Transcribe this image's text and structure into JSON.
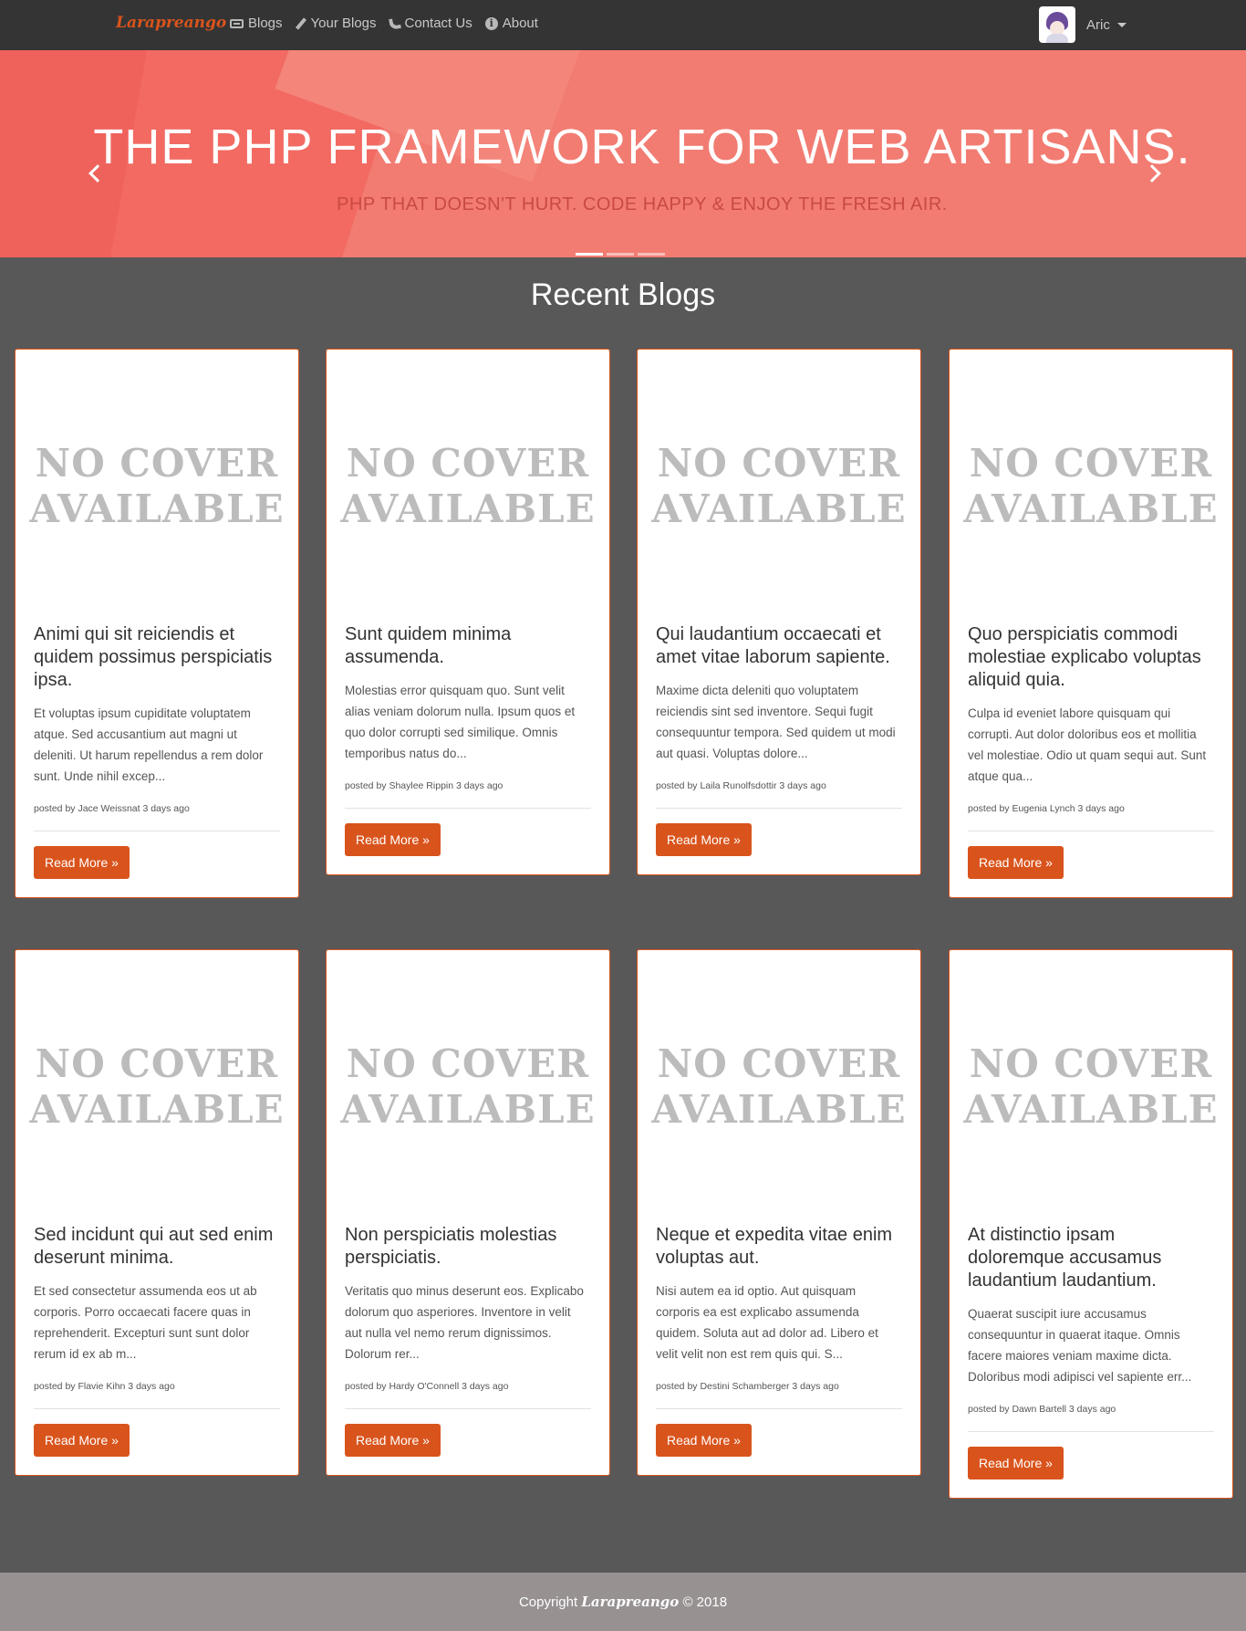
{
  "nav": {
    "brand": "Larapreango",
    "links": [
      {
        "label": "Blogs",
        "icon": "keyboard-icon"
      },
      {
        "label": "Your Blogs",
        "icon": "pencil-icon"
      },
      {
        "label": "Contact Us",
        "icon": "phone-icon"
      },
      {
        "label": "About",
        "icon": "info-icon"
      }
    ],
    "user": "Aric"
  },
  "hero": {
    "title": "THE PHP FRAMEWORK FOR WEB ARTISANS.",
    "subtitle": "PHP THAT DOESN'T HURT. CODE HAPPY & ENJOY THE FRESH AIR.",
    "slides": 3,
    "active_slide": 1
  },
  "section_title": "Recent Blogs",
  "cover_placeholder": [
    "NO COVER",
    "AVAILABLE"
  ],
  "read_more": "Read More »",
  "posts": [
    {
      "title": "Animi qui sit reiciendis et quidem possimus perspiciatis ipsa.",
      "excerpt": "Et voluptas ipsum cupiditate voluptatem atque. Sed accusantium aut magni ut deleniti. Ut harum repellendus a rem dolor sunt. Unde nihil excep...",
      "meta": "posted by Jace Weissnat 3 days ago"
    },
    {
      "title": "Sunt quidem minima assumenda.",
      "excerpt": "Molestias error quisquam quo. Sunt velit alias veniam dolorum nulla. Ipsum quos et quo dolor corrupti sed similique. Omnis temporibus natus do...",
      "meta": "posted by Shaylee Rippin 3 days ago"
    },
    {
      "title": "Qui laudantium occaecati et amet vitae laborum sapiente.",
      "excerpt": "Maxime dicta deleniti quo voluptatem reiciendis sint sed inventore. Sequi fugit consequuntur tempora. Sed quidem ut modi aut quasi. Voluptas dolore...",
      "meta": "posted by Laila Runolfsdottir 3 days ago"
    },
    {
      "title": "Quo perspiciatis commodi molestiae explicabo voluptas aliquid quia.",
      "excerpt": "Culpa id eveniet labore quisquam qui corrupti. Aut dolor doloribus eos et mollitia vel molestiae. Odio ut quam sequi aut. Sunt atque qua...",
      "meta": "posted by Eugenia Lynch 3 days ago"
    },
    {
      "title": "Sed incidunt qui aut sed enim deserunt minima.",
      "excerpt": "Et sed consectetur assumenda eos ut ab corporis. Porro occaecati facere quas in reprehenderit. Excepturi sunt sunt dolor rerum id ex ab m...",
      "meta": "posted by Flavie Kihn 3 days ago"
    },
    {
      "title": "Non perspiciatis molestias perspiciatis.",
      "excerpt": "Veritatis quo minus deserunt eos. Explicabo dolorum quo asperiores. Inventore in velit aut nulla vel nemo rerum dignissimos. Dolorum rer...",
      "meta": "posted by Hardy O'Connell 3 days ago"
    },
    {
      "title": "Neque et expedita vitae enim voluptas aut.",
      "excerpt": "Nisi autem ea id optio. Aut quisquam corporis ea est explicabo assumenda quidem. Soluta aut ad dolor ad. Libero et velit velit non est rem quis qui. S...",
      "meta": "posted by Destini Schamberger 3 days ago"
    },
    {
      "title": "At distinctio ipsam doloremque accusamus laudantium laudantium.",
      "excerpt": "Quaerat suscipit iure accusamus consequuntur in quaerat itaque. Omnis facere maiores veniam maxime dicta. Doloribus modi adipisci vel sapiente err...",
      "meta": "posted by Dawn Bartell 3 days ago"
    }
  ],
  "footer": {
    "prefix": "Copyright",
    "brand": "Larapreango",
    "suffix": "© 2018"
  },
  "colors": {
    "accent": "#d9541c",
    "navbar": "#343434",
    "hero": "#f27c72",
    "page": "#585858",
    "footer": "#979192"
  }
}
